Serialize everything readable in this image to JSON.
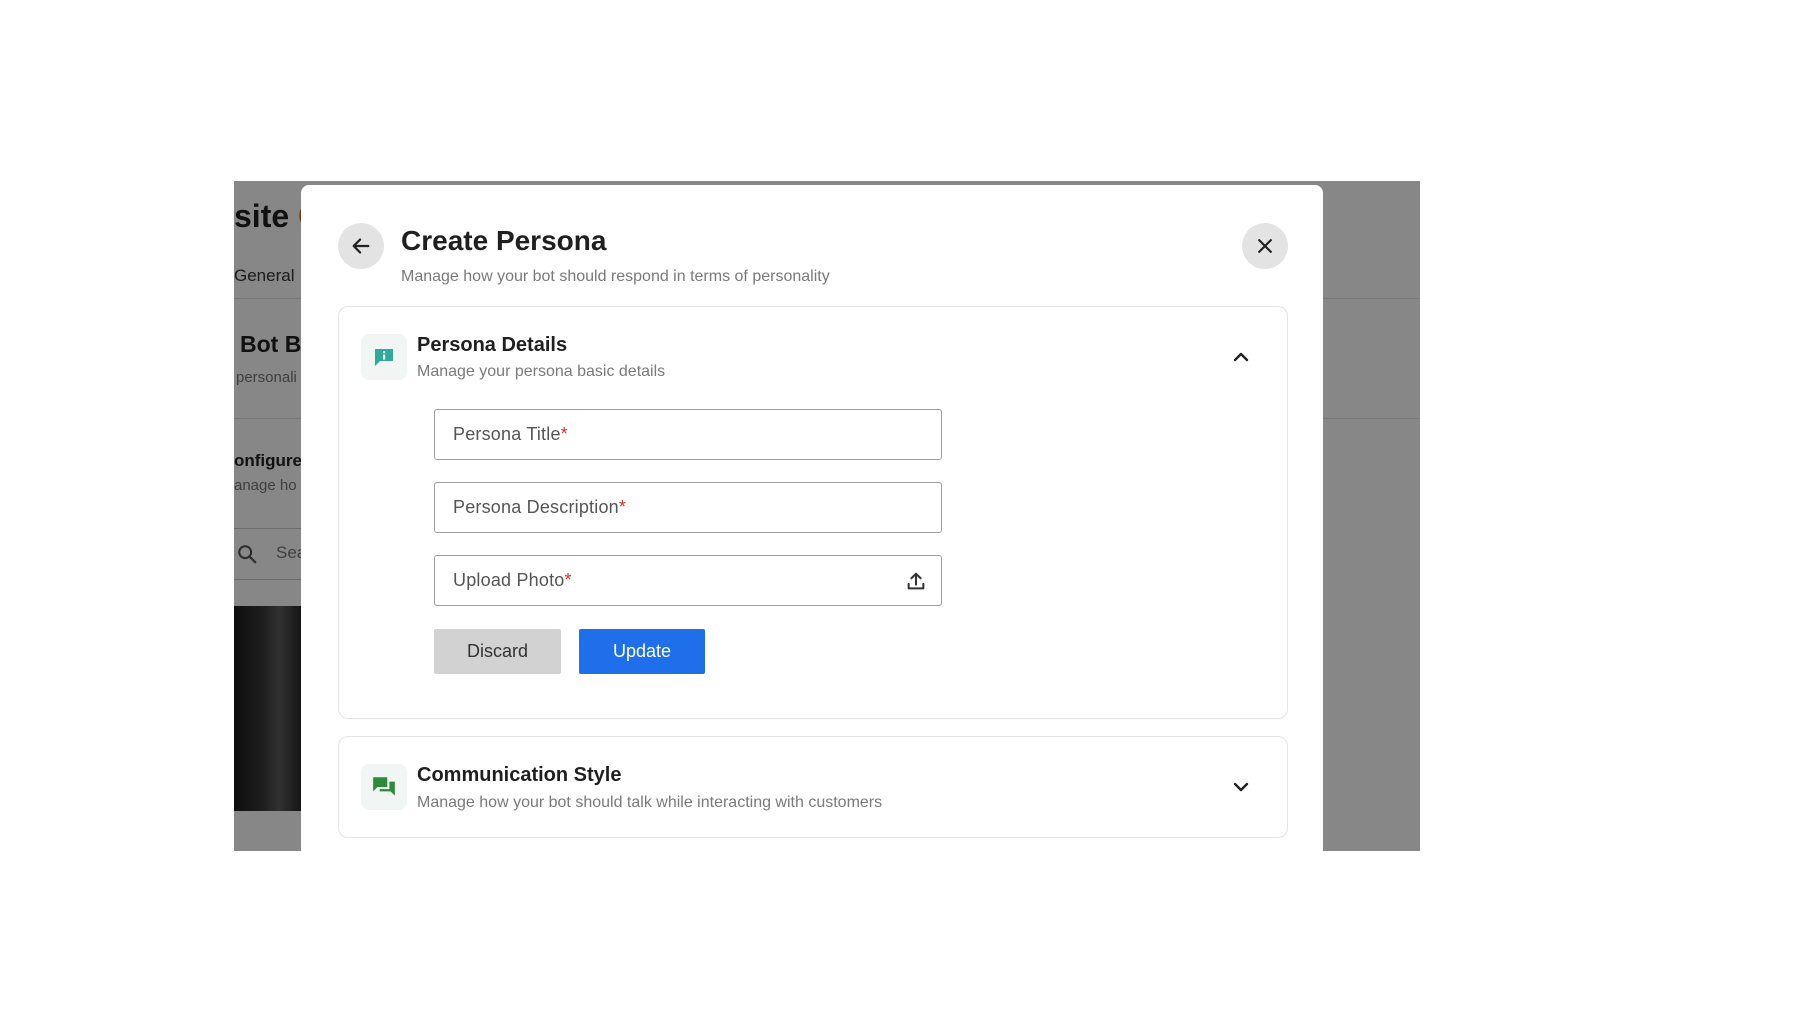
{
  "background": {
    "heading_partial": "site ",
    "heading_accent_partial": "C",
    "tab_partial": "General",
    "card_title_partial": "Bot B",
    "card_sub_partial": "personali",
    "section_title_partial": "onfigure",
    "section_sub_partial": "anage ho",
    "search_placeholder_partial": "Sea",
    "accent_color": "#e06a1a"
  },
  "modal": {
    "title": "Create Persona",
    "subtitle": "Manage how your bot should respond in terms of personality",
    "back_icon": "arrow-left-icon",
    "close_icon": "close-icon"
  },
  "persona_details": {
    "title": "Persona Details",
    "subtitle": "Manage your persona basic details",
    "icon": "info-chat-icon",
    "icon_color": "#2eaa9a",
    "expanded": true,
    "fields": {
      "title_label": "Persona Title",
      "description_label": "Persona Description",
      "photo_label": "Upload Photo",
      "required_mark": "*"
    },
    "discard_label": "Discard",
    "update_label": "Update",
    "update_color": "#1f6feb"
  },
  "communication_style": {
    "title": "Communication Style",
    "subtitle": "Manage how your bot should talk while interacting with customers",
    "icon": "chat-bubbles-icon",
    "icon_color": "#2e8b3a",
    "expanded": false
  }
}
